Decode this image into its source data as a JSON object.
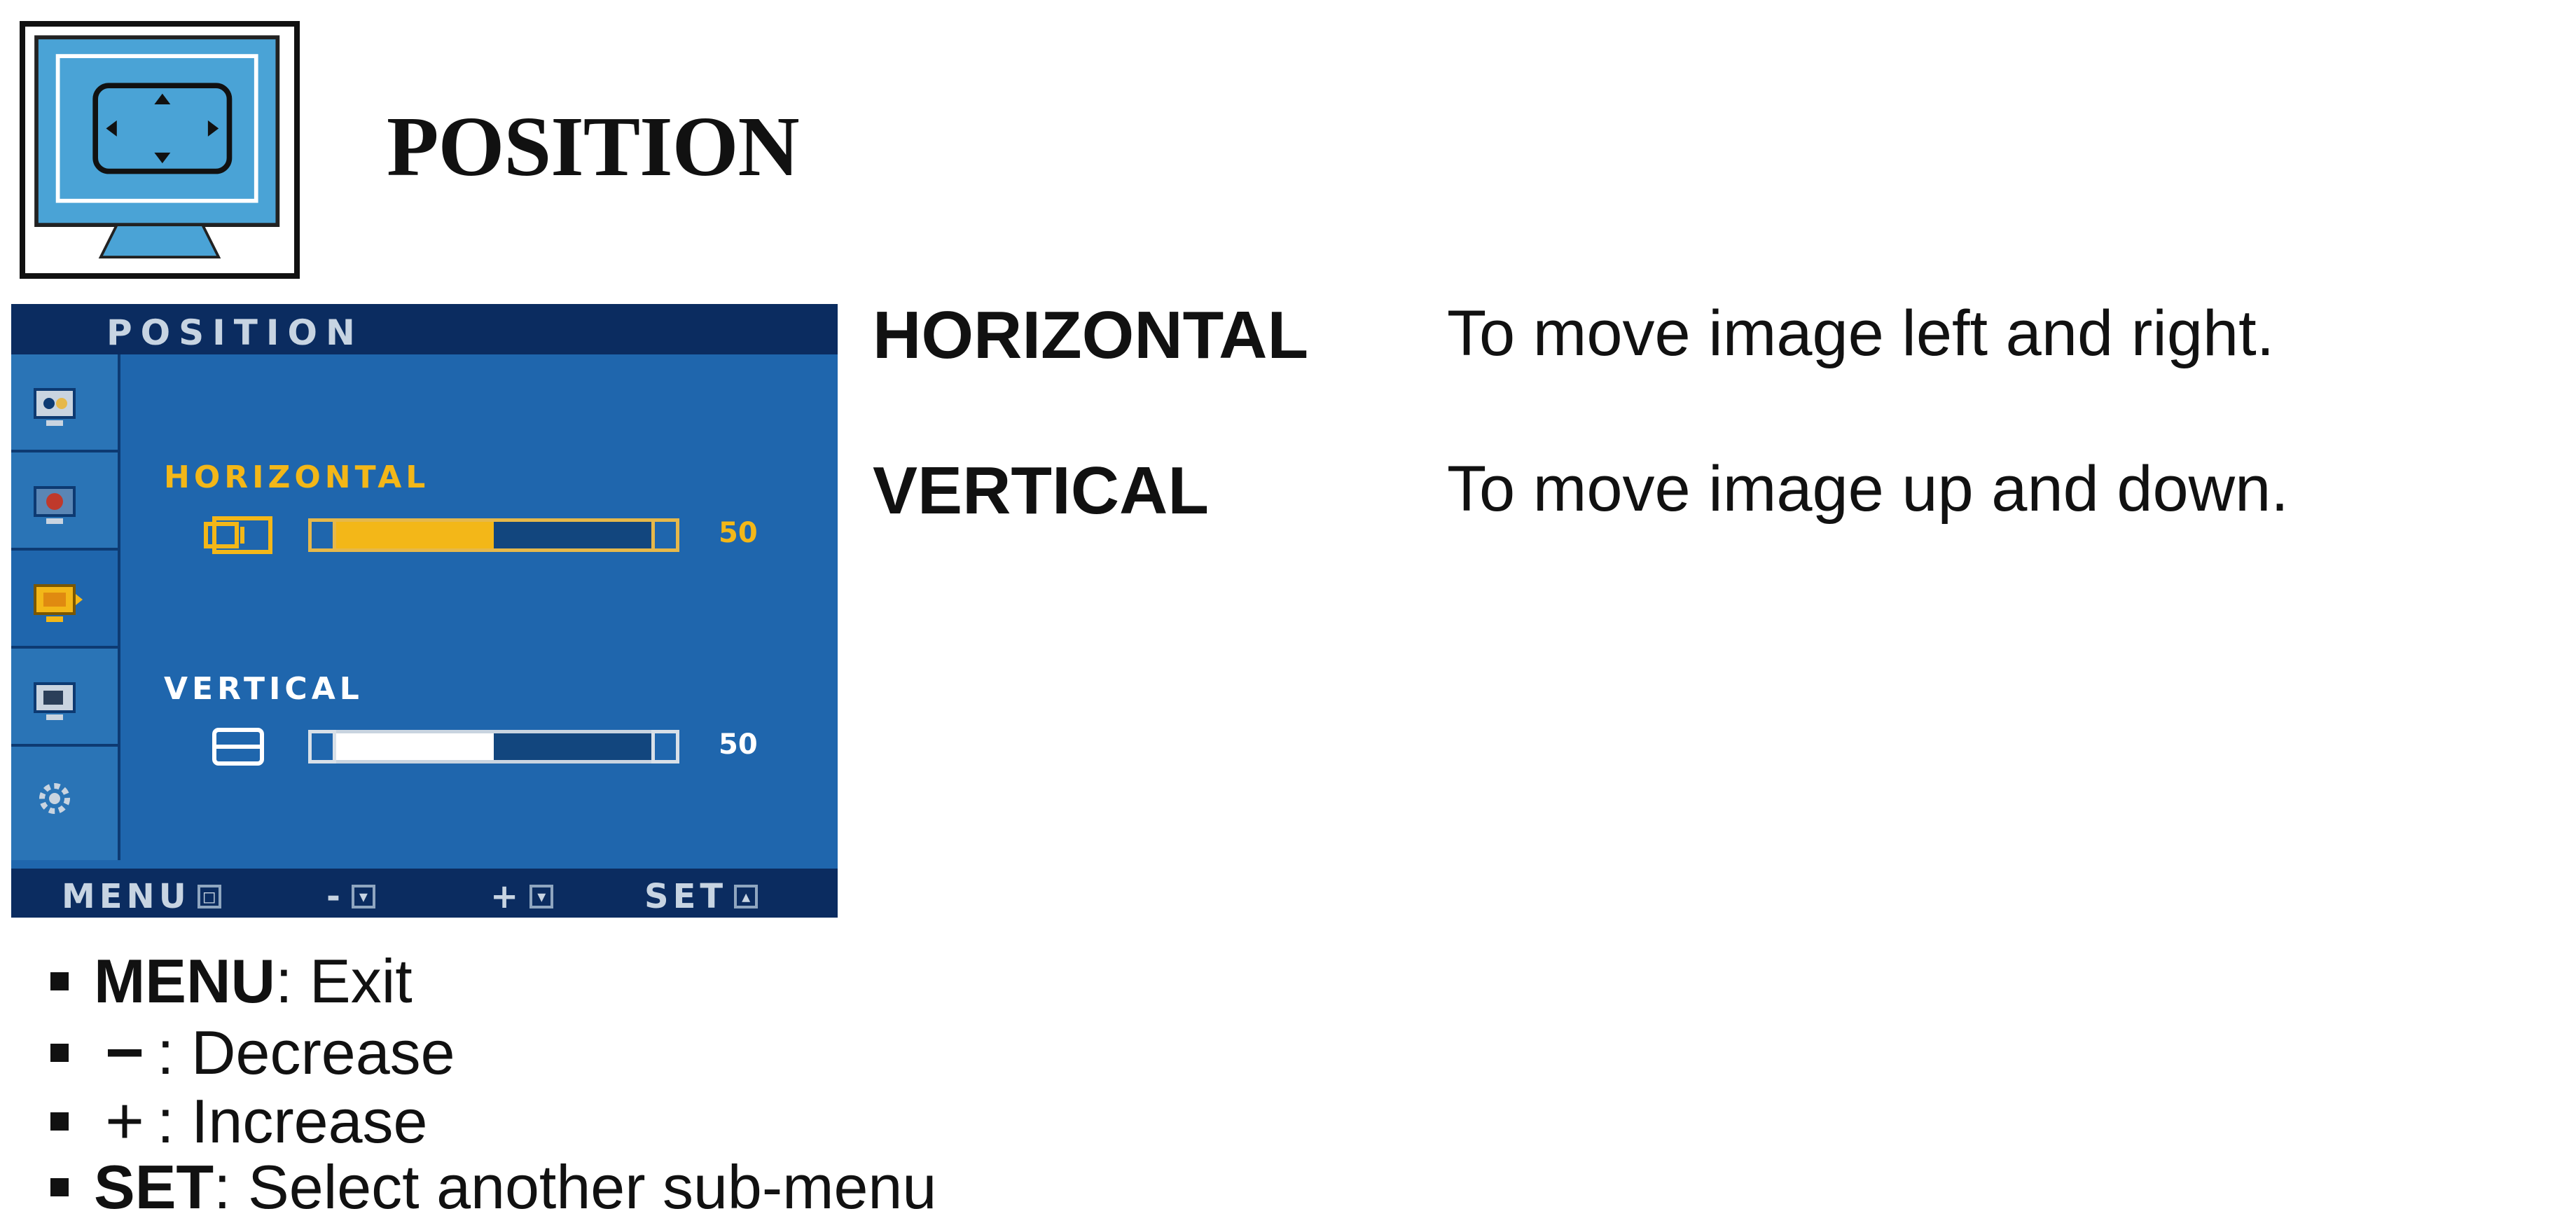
{
  "title": "POSITION",
  "osd": {
    "header_title": "POSITION",
    "horizontal": {
      "label": "HORIZONTAL",
      "value": "50",
      "level_percent": 50
    },
    "vertical": {
      "label": "VERTICAL",
      "value": "50",
      "level_percent": 50
    },
    "footer": {
      "menu": "MENU",
      "minus": "-",
      "plus": "+",
      "set": "SET"
    }
  },
  "descriptions": [
    {
      "term": "HORIZONTAL",
      "text": "To move image left and right."
    },
    {
      "term": "VERTICAL",
      "text": "To move image up and down."
    }
  ],
  "legend": [
    {
      "key": "MENU",
      "text": " : Exit"
    },
    {
      "key": "−",
      "text": " : Decrease"
    },
    {
      "key": "+",
      "text": " : Increase"
    },
    {
      "key": "SET",
      "text": " : Select another sub-menu"
    }
  ],
  "colors": {
    "osd_background": "#1f66ad",
    "osd_header": "#0b2c60",
    "selected_accent": "#f3b718"
  },
  "icons": {
    "section_icon": "monitor-position-icon",
    "sidebar": [
      "picture-icon",
      "color-icon",
      "position-icon",
      "tracking-icon",
      "setup-icon"
    ]
  }
}
